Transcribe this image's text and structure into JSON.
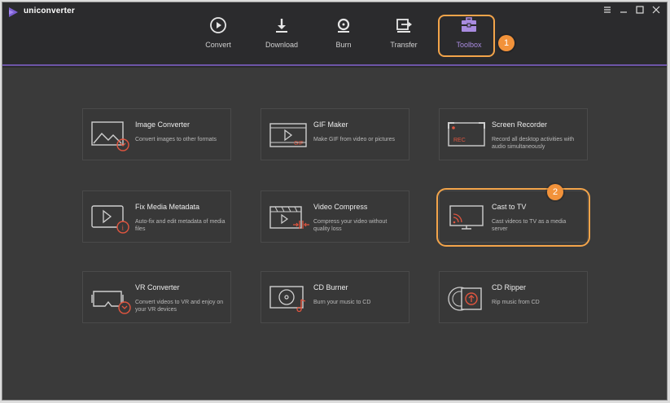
{
  "app": {
    "name": "uniconverter"
  },
  "nav": {
    "tabs": [
      {
        "label": "Convert",
        "icon": "convert-icon"
      },
      {
        "label": "Download",
        "icon": "download-icon"
      },
      {
        "label": "Burn",
        "icon": "burn-icon"
      },
      {
        "label": "Transfer",
        "icon": "transfer-icon"
      },
      {
        "label": "Toolbox",
        "icon": "toolbox-icon",
        "active": true
      }
    ]
  },
  "annotations": {
    "badge1": "1",
    "badge2": "2"
  },
  "tools": [
    {
      "title": "Image Converter",
      "desc": "Convert images to other formats",
      "icon": "image-converter-icon"
    },
    {
      "title": "GIF Maker",
      "desc": "Make GIF from video or pictures",
      "icon": "gif-maker-icon",
      "icon_text": "GIF"
    },
    {
      "title": "Screen Recorder",
      "desc": "Record all desktop activities with audio simultaneously",
      "icon": "screen-recorder-icon",
      "icon_text": "REC"
    },
    {
      "title": "Fix Media Metadata",
      "desc": "Auto-fix and edit metadata of media files",
      "icon": "fix-metadata-icon"
    },
    {
      "title": "Video Compress",
      "desc": "Compress your video without quality loss",
      "icon": "video-compress-icon"
    },
    {
      "title": "Cast to TV",
      "desc": "Cast videos to TV as a media server",
      "icon": "cast-tv-icon"
    },
    {
      "title": "VR Converter",
      "desc": "Convert videos to VR and enjoy on your VR devices",
      "icon": "vr-converter-icon"
    },
    {
      "title": "CD Burner",
      "desc": "Burn your music to CD",
      "icon": "cd-burner-icon"
    },
    {
      "title": "CD Ripper",
      "desc": "Rip music from CD",
      "icon": "cd-ripper-icon"
    }
  ],
  "colors": {
    "accent": "#6d55a8",
    "active_tab": "#a98be0",
    "highlight": "#f3a44a",
    "icon_red": "#e0553f",
    "background": "#3a3a3a",
    "titlebar": "#2b2b2d"
  }
}
